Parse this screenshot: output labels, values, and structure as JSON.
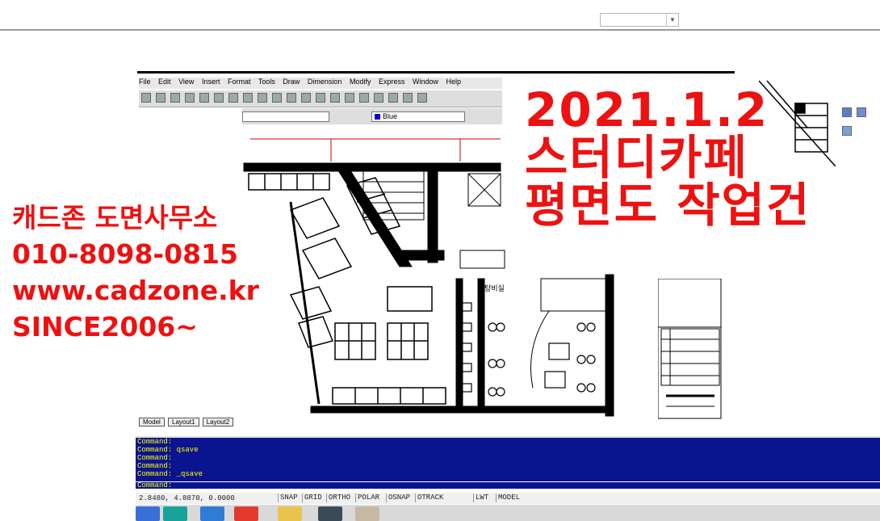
{
  "overlay": {
    "left_lines": [
      "캐드존 도면사무소",
      "010-8098-0815",
      "www.cadzone.kr",
      "SINCE2006~"
    ],
    "right_lines": [
      "2021.1.2",
      "스터디카페",
      "평면도 작업건"
    ],
    "color": "#ee1111"
  },
  "cad": {
    "menu": [
      "File",
      "Edit",
      "View",
      "Insert",
      "Format",
      "Tools",
      "Draw",
      "Dimension",
      "Modify",
      "Express",
      "Window",
      "Help"
    ],
    "color_value": "Blue",
    "color_swatch": "#0000cc",
    "layout_tabs": [
      "Model",
      "Layout1",
      "Layout2"
    ],
    "command_lines": [
      "Command:",
      "Command:  qsave",
      "Command:",
      "Command:",
      "Command: _qsave"
    ],
    "command_prompt": "Command:",
    "status_coords": "2.8480, 4.8870, 0.0000",
    "status_buttons": [
      "SNAP",
      "GRID",
      "ORTHO",
      "POLAR",
      "OSNAP",
      "OTRACK",
      "LWT",
      "MODEL"
    ],
    "command_bg": "#0a148e",
    "command_fg": "#ffff00"
  },
  "plan_labels": {
    "room_label": "탕비실"
  }
}
